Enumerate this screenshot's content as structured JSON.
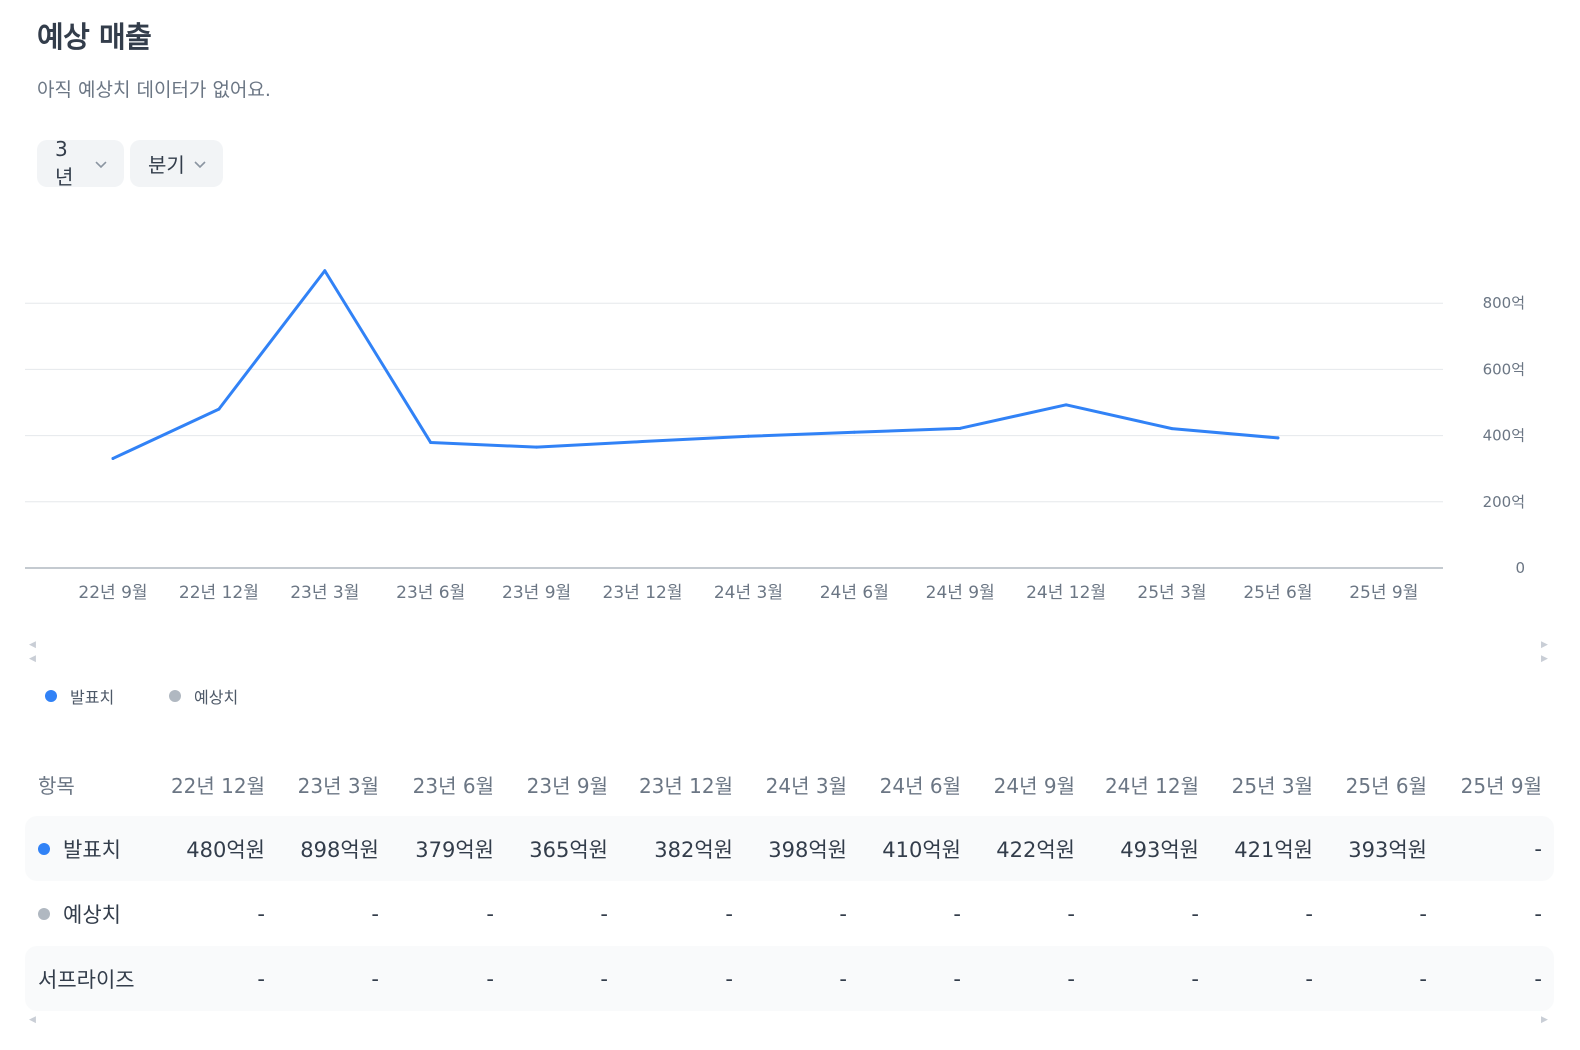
{
  "header": {
    "title": "예상 매출",
    "subtitle": "아직 예상치 데이터가 없어요."
  },
  "filters": {
    "period": "3년",
    "unit": "분기"
  },
  "chart_data": {
    "type": "line",
    "categories": [
      "22년 9월",
      "22년 12월",
      "23년 3월",
      "23년 6월",
      "23년 9월",
      "23년 12월",
      "24년 3월",
      "24년 6월",
      "24년 9월",
      "24년 12월",
      "25년 3월",
      "25년 6월",
      "25년 9월"
    ],
    "series": [
      {
        "name": "발표치",
        "color": "#3182f6",
        "values": [
          331,
          480,
          898,
          379,
          365,
          382,
          398,
          410,
          422,
          493,
          421,
          393,
          null
        ]
      },
      {
        "name": "예상치",
        "color": "#b0b8c1",
        "values": [
          null,
          null,
          null,
          null,
          null,
          null,
          null,
          null,
          null,
          null,
          null,
          null,
          null
        ]
      }
    ],
    "y_ticks": [
      0,
      200,
      400,
      600,
      800
    ],
    "y_tick_labels": [
      "0",
      "200억",
      "400억",
      "600억",
      "800억"
    ],
    "ylim": [
      0,
      1000
    ],
    "y_axis_position": "right",
    "grid": true,
    "legend_position": "bottom-left"
  },
  "legend": {
    "actual": "발표치",
    "estimate": "예상치"
  },
  "table": {
    "header_label": "항목",
    "columns": [
      "22년 12월",
      "23년 3월",
      "23년 6월",
      "23년 9월",
      "23년 12월",
      "24년 3월",
      "24년 6월",
      "24년 9월",
      "24년 12월",
      "25년 3월",
      "25년 6월",
      "25년 9월"
    ],
    "rows": [
      {
        "label": "발표치",
        "dot_color": "#3182f6",
        "values": [
          "480억원",
          "898억원",
          "379억원",
          "365억원",
          "382억원",
          "398억원",
          "410억원",
          "422억원",
          "493억원",
          "421억원",
          "393억원",
          "-"
        ]
      },
      {
        "label": "예상치",
        "dot_color": "#b0b8c1",
        "values": [
          "-",
          "-",
          "-",
          "-",
          "-",
          "-",
          "-",
          "-",
          "-",
          "-",
          "-",
          "-"
        ]
      },
      {
        "label": "서프라이즈",
        "dot_color": "",
        "values": [
          "-",
          "-",
          "-",
          "-",
          "-",
          "-",
          "-",
          "-",
          "-",
          "-",
          "-",
          "-"
        ]
      }
    ]
  }
}
